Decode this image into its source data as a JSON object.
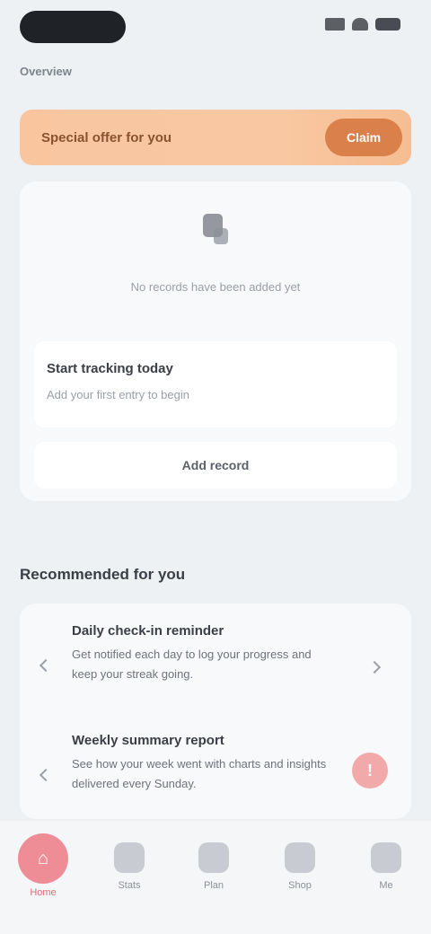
{
  "header": {
    "section_label": "Overview"
  },
  "promo": {
    "text": "Special offer for you",
    "cta_label": "Claim"
  },
  "main_card": {
    "empty_icon": "scale-icon",
    "empty_text": "No records have been added yet",
    "info_title": "Start tracking today",
    "info_subtitle": "Add your first entry to begin",
    "button_label": "Add record"
  },
  "section": {
    "title": "Recommended for you"
  },
  "list": {
    "items": [
      {
        "title": "Daily check-in reminder",
        "description": "Get notified each day to log your progress and keep your streak going."
      },
      {
        "title": "Weekly summary report",
        "description": "See how your week went with charts and insights delivered every Sunday."
      }
    ],
    "badge_text": "!"
  },
  "nav": {
    "items": [
      {
        "label": "Home",
        "icon": "home-icon"
      },
      {
        "label": "Stats",
        "icon": "chart-icon"
      },
      {
        "label": "Plan",
        "icon": "calendar-icon"
      },
      {
        "label": "Shop",
        "icon": "bag-icon"
      },
      {
        "label": "Me",
        "icon": "user-icon"
      }
    ]
  },
  "colors": {
    "accent": "#ef8d96",
    "promo": "#f8c59f",
    "promo_cta": "#d9804b"
  }
}
